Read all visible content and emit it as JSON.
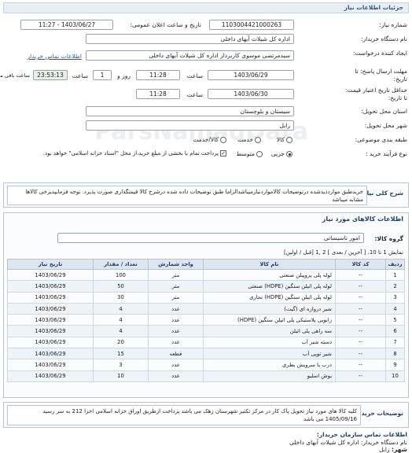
{
  "header": {
    "title": "جزئیات اطلاعات نیاز"
  },
  "form": {
    "need_number_label": "شماره نیاز:",
    "need_number": "1103004421000263",
    "announce_label": "تاریخ و ساعت اعلان عمومی:",
    "announce_value": "1403/06/27 - 11:27",
    "buyer_label": "نام دستگاه خریدار:",
    "buyer_value": "اداره کل شیلات آبهای داخلی",
    "creator_label": "ایجاد کننده درخواست:",
    "creator_value": "سیدمرتضی موسوی کاربرداز اداره کل شیلات آبهای داخلی",
    "contact_link": "اطلاعات تماس خریدار",
    "reply_deadline_label": "مهلت ارسال پاسخ: تا تاریخ:",
    "reply_date": "1403/06/29",
    "hour_label": "ساعت",
    "reply_time": "11:28",
    "day_value": "1",
    "day_label": "روز و",
    "timer_value": "23:53:13",
    "remaining_label": "ساعت باقی مانده",
    "validity_label": "حداقل تاریخ اعتبار قیمت: تا تاریخ:",
    "validity_date": "1403/06/30",
    "validity_time": "11:28",
    "province_label": "استان محل تحویل:",
    "province_value": "سیستان و بلوچستان",
    "city_label": "شهر محل تحویل:",
    "city_value": "زابل",
    "category_label": "طبقه بندی موضوعی:",
    "category_options": [
      "کالا",
      "خدمت",
      "کالا/خدمت"
    ],
    "process_label": "نوع فرآیند خرید :",
    "process_options": [
      "جزیی",
      "متوسط"
    ],
    "payment_note": "پرداخت تمام یا بخشی از مبلغ خرید،از محل \"اسناد خزانه اسلامی\" خواهد بود."
  },
  "description": {
    "label": "شرح کلی نیاز:",
    "text": "خریدطبق مواردذیدشده درتوضیحات کالامواردنیازمیباشدالزاما طبق توضیحات داده شده درشرح کالا قیمتگذاری صورت پذیرد. توجه فرمایپدیرخی کالاها مشابه میباشد"
  },
  "goods": {
    "section_title": "اطلاعات کالاهای مورد نیاز",
    "group_label": "گروه کالا:",
    "group_value": "امور تاسیساتی",
    "pagination": "نمایش 1 تا 10، [ آخرین / بعدی ] 2 ,1 [قبل / اولین]",
    "columns": [
      "ردیف",
      "کد کالا",
      "نام کالا",
      "واحد شمارش",
      "تعداد / مقدار",
      "تاریخ نیاز"
    ],
    "rows": [
      [
        "1",
        "--",
        "لوله پلی پروپیلن صنعتی",
        "متر",
        "100",
        "1403/06/29"
      ],
      [
        "2",
        "--",
        "لوله پلی اتیلن سنگین (HDPE) صنعتی",
        "متر",
        "50",
        "1403/06/29"
      ],
      [
        "3",
        "--",
        "لوله پلی اتیلن سنگین (HDPE) تجاری",
        "متر",
        "30",
        "1403/06/29"
      ],
      [
        "4",
        "--",
        "شیر دروازه ای (گیت)",
        "عدد",
        "4",
        "1403/06/29"
      ],
      [
        "5",
        "--",
        "زانویی پلاستیکی پلی اتیلن سنگین (HDPE)",
        "عدد",
        "4",
        "1403/06/29"
      ],
      [
        "6",
        "--",
        "سه راهی پلی اتیلن",
        "عدد",
        "4",
        "1403/06/29"
      ],
      [
        "7",
        "--",
        "دسته شیر آب",
        "عدد",
        "20",
        "1403/06/29"
      ],
      [
        "8",
        "--",
        "شیر توپی آب",
        "قطعه",
        "15",
        "1403/06/29"
      ],
      [
        "9",
        "--",
        "درب با سرویش بطری",
        "عدد",
        "3",
        "1403/06/29"
      ],
      [
        "10",
        "--",
        "بوش اسلیو",
        "عدد",
        "10",
        "1403/06/29"
      ]
    ]
  },
  "notes": {
    "label": "توضیحات خریدار:",
    "text": "کلیه کالا های مورد نیاز تحویل پاک کار در مرکز تکثیر شهرستان زهک می باشد پرداخت ازطریق اوراق خزانه اسلامی اخزا 212 به سر رسید 1405/09/16 می باشد"
  },
  "footer": {
    "title": "اطلاعات تماس سازمان خریدار:",
    "buyer_label": "نام دستگاه خریدار:",
    "buyer_value": "اداره کل شیلات آبهای داخلی",
    "city_label": "شهر:",
    "city_value": "زابل"
  },
  "watermark": "ParsNamadData"
}
